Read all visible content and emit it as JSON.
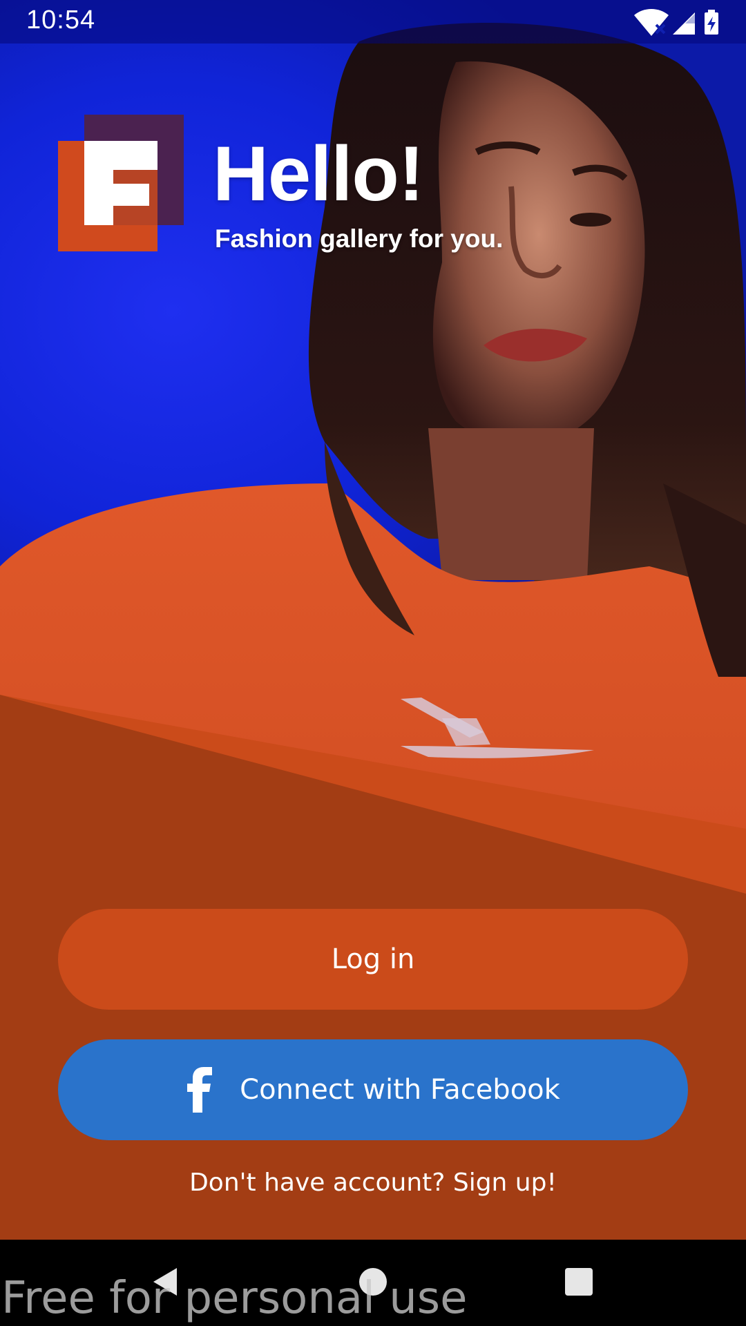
{
  "status_bar": {
    "time": "10:54",
    "icons": [
      "wifi-off-icon",
      "cellular-signal-icon",
      "battery-charging-icon"
    ]
  },
  "brand": {
    "logo_letter": "F",
    "title": "Hello!",
    "subtitle": "Fashion gallery for you."
  },
  "actions": {
    "login_label": "Log in",
    "facebook_label": "Connect with Facebook",
    "signup_label": "Don't have account? Sign up!"
  },
  "navigation": {
    "buttons": [
      "back",
      "home",
      "recents"
    ]
  },
  "watermark": "Free for personal use",
  "colors": {
    "background_blue": "#1024d8",
    "panel_orange_dark": "#a33d14",
    "panel_orange_light": "#cb4b1a",
    "facebook_blue": "#2a73cb",
    "logo_orange": "#d04a1e",
    "logo_purple": "#4b2250"
  }
}
